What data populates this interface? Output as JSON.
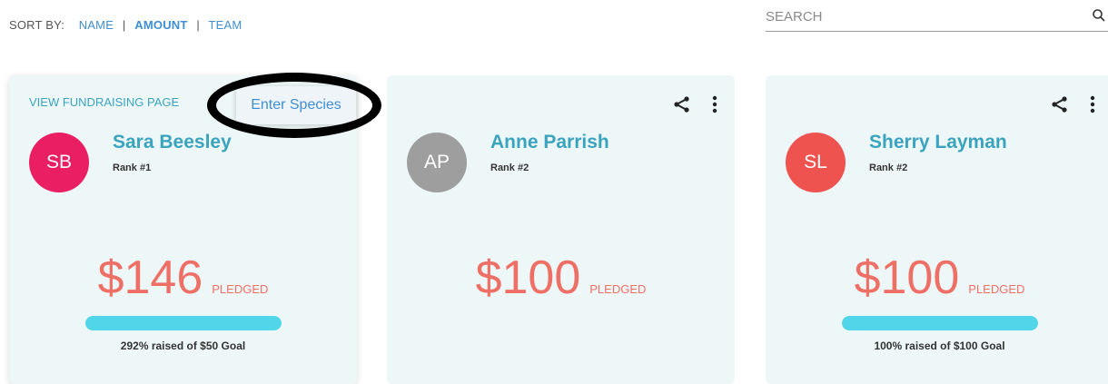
{
  "sort": {
    "label": "SORT BY:",
    "options": [
      "NAME",
      "AMOUNT",
      "TEAM"
    ],
    "active": "AMOUNT"
  },
  "search": {
    "placeholder": "SEARCH",
    "icon": "search-icon"
  },
  "popup": {
    "item": "Enter Species"
  },
  "cards": [
    {
      "link": "VIEW FUNDRAISING PAGE",
      "initials": "SB",
      "avatar_color": "#e91e63",
      "name": "Sara Beesley",
      "rank": "Rank #1",
      "amount": "$146",
      "pledged_label": "PLEDGED",
      "progress_fraction": 1.0,
      "goal_text": "292% raised of $50 Goal"
    },
    {
      "initials": "AP",
      "avatar_color": "#9e9e9e",
      "name": "Anne Parrish",
      "rank": "Rank #2",
      "amount": "$100",
      "pledged_label": "PLEDGED",
      "progress_fraction": null,
      "goal_text": ""
    },
    {
      "initials": "SL",
      "avatar_color": "#ef5350",
      "name": "Sherry Layman",
      "rank": "Rank #2",
      "amount": "$100",
      "pledged_label": "PLEDGED",
      "progress_fraction": 1.0,
      "goal_text": "100% raised of $100 Goal"
    }
  ],
  "colors": {
    "accent_link": "#3f8fd2",
    "name_teal": "#3aa3bd",
    "amount_coral": "#ee6f66",
    "progress": "#51d5e9",
    "card_bg": "#eef7f8"
  }
}
